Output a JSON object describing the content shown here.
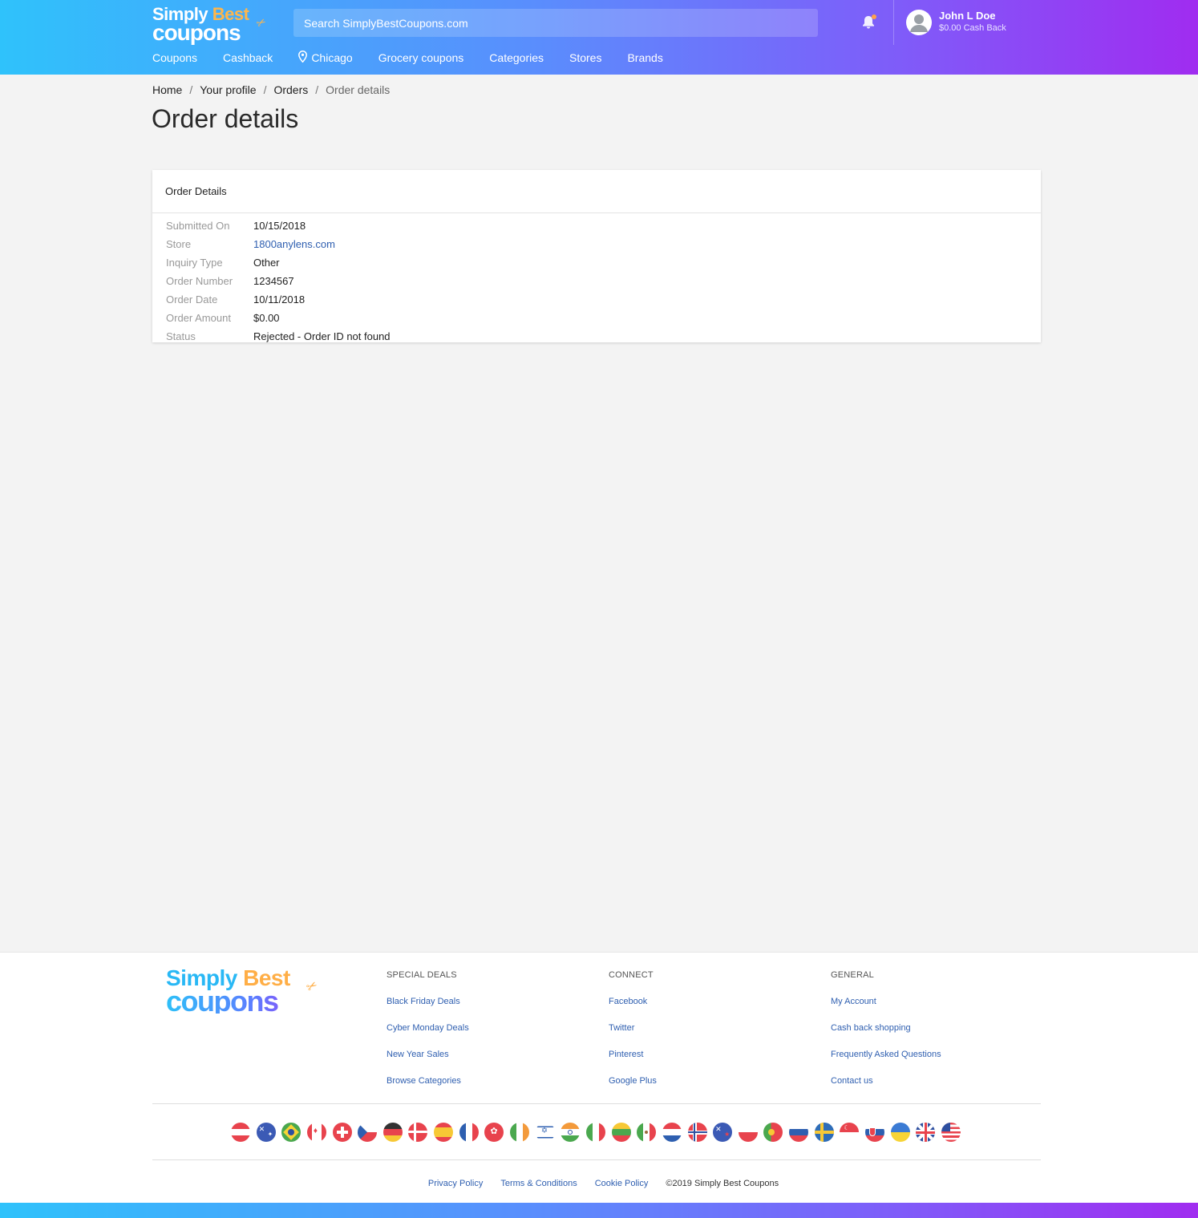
{
  "header": {
    "logo": {
      "line1_a": "Simply",
      "line1_b": "Best",
      "line2": "coupons"
    },
    "search_placeholder": "Search SimplyBestCoupons.com",
    "user": {
      "name": "John L Doe",
      "cash_back": "$0.00 Cash Back"
    },
    "nav": [
      {
        "label": "Coupons"
      },
      {
        "label": "Cashback"
      },
      {
        "label": "Chicago",
        "icon": "location-pin-icon"
      },
      {
        "label": "Grocery coupons"
      },
      {
        "label": "Categories"
      },
      {
        "label": "Stores"
      },
      {
        "label": "Brands"
      }
    ]
  },
  "breadcrumb": [
    "Home",
    "Your profile",
    "Orders",
    "Order details"
  ],
  "page_title": "Order details",
  "card": {
    "title": "Order Details",
    "rows": [
      {
        "label": "Submitted On",
        "value": "10/15/2018"
      },
      {
        "label": "Store",
        "value": "1800anylens.com"
      },
      {
        "label": "Inquiry Type",
        "value": "Other"
      },
      {
        "label": "Order Number",
        "value": "1234567"
      },
      {
        "label": "Order Date",
        "value": "10/11/2018"
      },
      {
        "label": "Order Amount",
        "value": "$0.00"
      },
      {
        "label": "Status",
        "value": "Rejected - Order ID not found"
      }
    ]
  },
  "footer": {
    "logo": {
      "line1_a": "Simply",
      "line1_b": "Best",
      "line2": "coupons"
    },
    "columns": [
      {
        "heading": "SPECIAL DEALS",
        "links": [
          "Black Friday Deals",
          "Cyber Monday Deals",
          "New Year Sales",
          "Browse Categories"
        ]
      },
      {
        "heading": "CONNECT",
        "links": [
          "Facebook",
          "Twitter",
          "Pinterest",
          "Google Plus"
        ]
      },
      {
        "heading": "GENERAL",
        "links": [
          "My Account",
          "Cash back shopping",
          "Frequently Asked Questions",
          "Contact us"
        ]
      }
    ],
    "flags": [
      "austria-flag-icon",
      "australia-flag-icon",
      "brazil-flag-icon",
      "canada-flag-icon",
      "switzerland-flag-icon",
      "czech-flag-icon",
      "germany-flag-icon",
      "denmark-flag-icon",
      "spain-flag-icon",
      "france-flag-icon",
      "hong-kong-flag-icon",
      "ireland-flag-icon",
      "israel-flag-icon",
      "india-flag-icon",
      "italy-flag-icon",
      "lithuania-flag-icon",
      "mexico-flag-icon",
      "netherlands-flag-icon",
      "norway-flag-icon",
      "new-zealand-flag-icon",
      "poland-flag-icon",
      "portugal-flag-icon",
      "russia-flag-icon",
      "sweden-flag-icon",
      "singapore-flag-icon",
      "slovakia-flag-icon",
      "ukraine-flag-icon",
      "uk-flag-icon",
      "usa-flag-icon"
    ],
    "bottom_links": [
      "Privacy Policy",
      "Terms & Conditions",
      "Cookie Policy"
    ],
    "copyright": "©2019 Simply Best Coupons"
  },
  "colors": {
    "link": "#2f5fb0",
    "gradient_start": "#2fc2fb",
    "gradient_end": "#a02cf0",
    "accent": "#ffb64a"
  }
}
